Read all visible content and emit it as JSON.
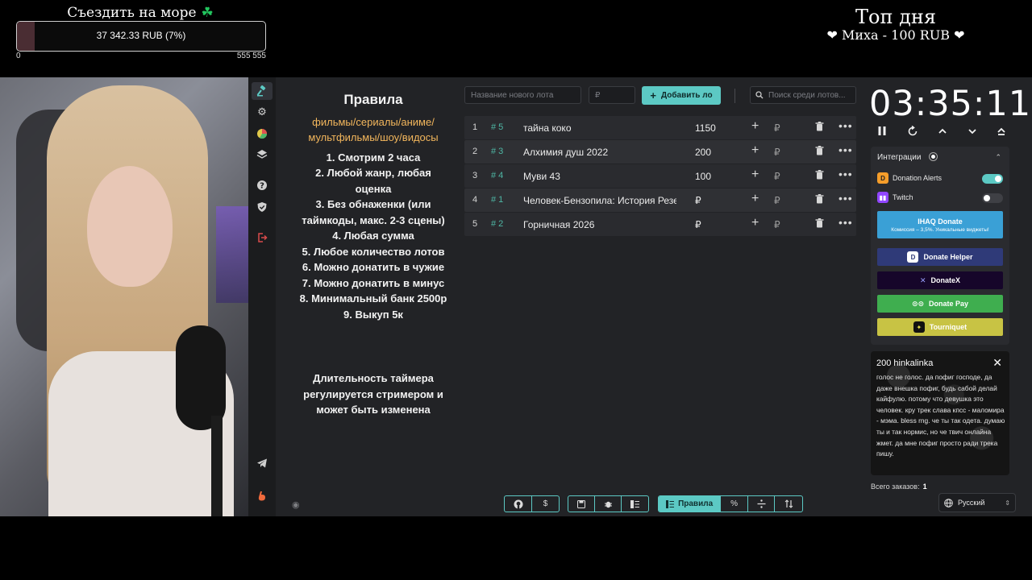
{
  "goal": {
    "title": "Съездить на море",
    "amount_text": "37 342.33 RUB (7%)",
    "progress_fraction": 0.07,
    "min_label": "0",
    "max_label": "555 555"
  },
  "top_day": {
    "title": "Топ дня",
    "line": "❤ Миха - 100 RUB ❤"
  },
  "rules": {
    "title": "Правила",
    "categories": [
      "фильмы/сериалы/аниме/",
      "мультфильмы/шоу/видосы"
    ],
    "items": [
      "1. Смотрим 2 часа",
      "2. Любой жанр, любая",
      "оценка",
      "3. Без обнаженки (или",
      "таймкоды, макс. 2-3 сцены)",
      "4. Любая сумма",
      "5. Любое количество лотов",
      "6. Можно донатить в чужие",
      "7. Можно донатить в минус",
      "8. Минимальный банк 2500р",
      "9. Выкуп 5к"
    ],
    "note": [
      "Длительность таймера",
      "регулируется стримером и",
      "может быть изменена"
    ]
  },
  "toolbar": {
    "lot_name_placeholder": "Название нового лота",
    "amount_placeholder": "₽",
    "add_label": "Добавить ло",
    "search_placeholder": "Поиск среди лотов..."
  },
  "lots": [
    {
      "num": "1",
      "hash": "# 5",
      "name": "тайна коко",
      "amount": "1150"
    },
    {
      "num": "2",
      "hash": "# 3",
      "name": "Алхимия душ 2022",
      "amount": "200"
    },
    {
      "num": "3",
      "hash": "# 4",
      "name": "Муви 43",
      "amount": "100"
    },
    {
      "num": "4",
      "hash": "# 1",
      "name": "Человек-Бензопила: История Резе",
      "amount": "₽"
    },
    {
      "num": "5",
      "hash": "# 2",
      "name": "Горничная 2026",
      "amount": "₽"
    }
  ],
  "currency_symbol": "₽",
  "bottom_bar": {
    "rules_label": "Правила",
    "dollar": "$",
    "percent": "%"
  },
  "timer": {
    "value": "03:35:11"
  },
  "integrations": {
    "title": "Интеграции",
    "services": [
      {
        "name": "Donation Alerts",
        "enabled": true
      },
      {
        "name": "Twitch",
        "enabled": false
      }
    ],
    "ihaq": {
      "label": "IHAQ Donate",
      "sub": "Комиссия – 3,5%. Уникальные виджеты!"
    },
    "buttons": [
      {
        "label": "Donate Helper",
        "color": "#2f3a78"
      },
      {
        "label": "DonateX",
        "color": "#16062a"
      },
      {
        "label": "Donate Pay",
        "color": "#3fae4f"
      },
      {
        "label": "Tourniquet",
        "color": "#c8c344"
      }
    ]
  },
  "alert": {
    "header": "200 hinkalinka",
    "message": "голос не голос. да пофиг господе, да даже внешка пофиг, будь сабой делай кайфулю. потому что девушка это человек. кру трек слава кпсс - маломира - мэма. bless rng. че ты так одета. думаю ты и так нормис, но че твич онлайна жмет. да мне пофиг просто ради трека пишу."
  },
  "orders": {
    "label": "Всего заказов:",
    "count": "1"
  },
  "language": {
    "selected": "Русский"
  }
}
